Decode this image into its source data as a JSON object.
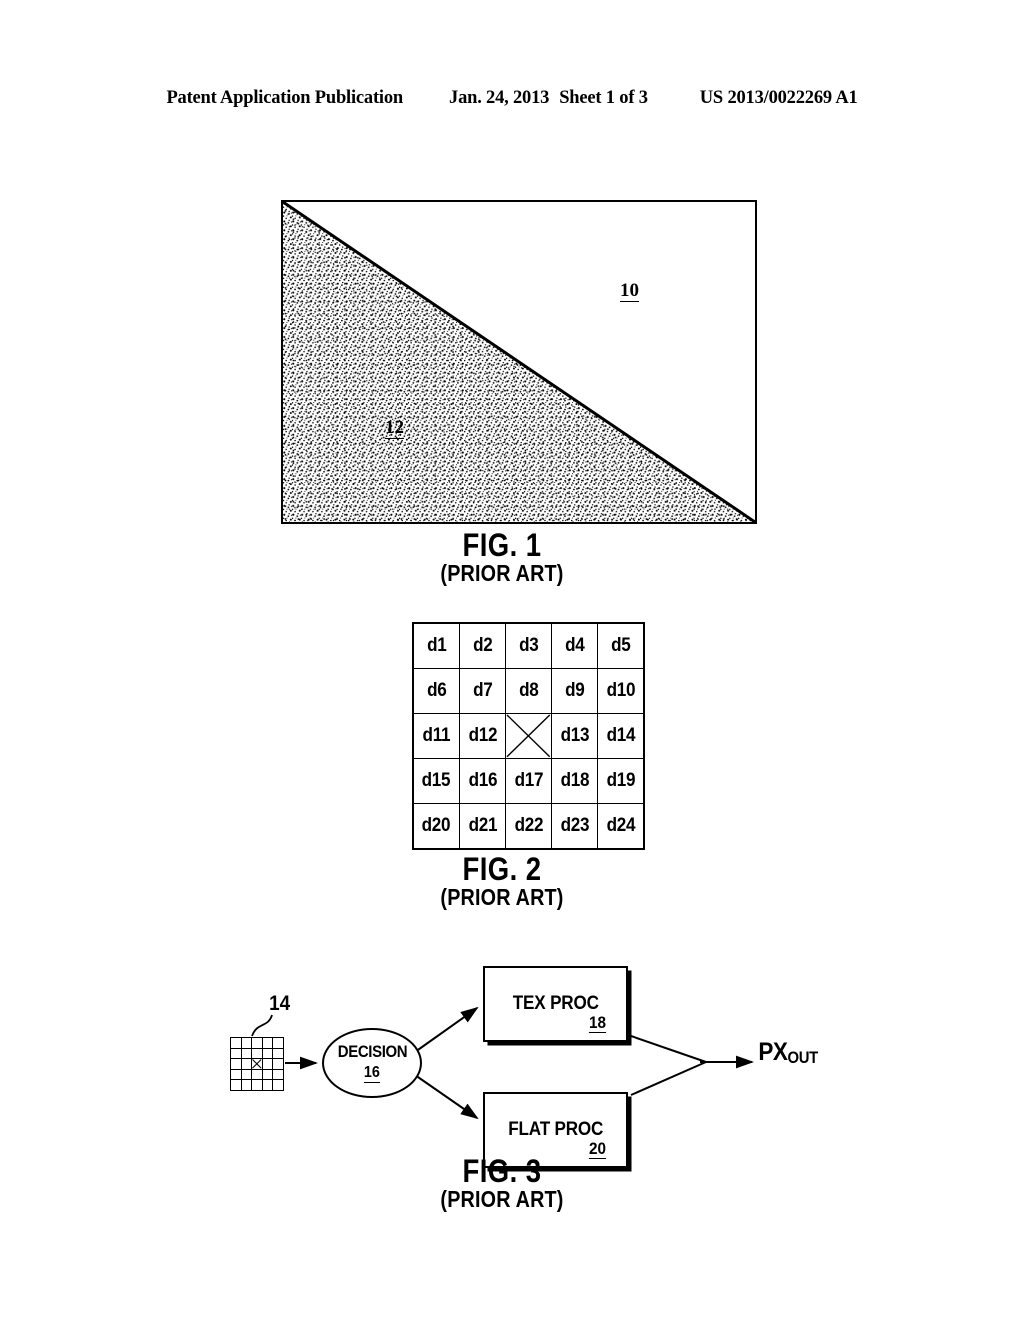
{
  "header": {
    "publication": "Patent Application Publication",
    "date": "Jan. 24, 2013",
    "sheet": "Sheet 1 of 3",
    "patent_number": "US 2013/0022269 A1"
  },
  "figures": [
    {
      "id": "fig1",
      "number": "FIG. 1",
      "subtitle": "(PRIOR ART)",
      "type": "stippled-triangle-diagram",
      "refs": [
        {
          "label": "10",
          "region": "white-upper-right-region"
        },
        {
          "label": "12",
          "region": "stippled-lower-left-triangle"
        }
      ]
    },
    {
      "id": "fig2",
      "number": "FIG. 2",
      "subtitle": "(PRIOR ART)",
      "type": "pixel-neighborhood-grid",
      "grid": {
        "rows": 5,
        "cols": 5,
        "center_marker": "x-cross",
        "cells": [
          [
            "d1",
            "d2",
            "d3",
            "d4",
            "d5"
          ],
          [
            "d6",
            "d7",
            "d8",
            "d9",
            "d10"
          ],
          [
            "d11",
            "d12",
            "",
            "d13",
            "d14"
          ],
          [
            "d15",
            "d16",
            "d17",
            "d18",
            "d19"
          ],
          [
            "d20",
            "d21",
            "d22",
            "d23",
            "d24"
          ]
        ]
      }
    },
    {
      "id": "fig3",
      "number": "FIG. 3",
      "subtitle": "(PRIOR ART)",
      "type": "block-flow-diagram",
      "nodes": {
        "input_grid": {
          "ref": "14",
          "rows": 5,
          "cols": 5,
          "center_marker": "x-cross"
        },
        "decision": {
          "label": "DECISION",
          "ref": "16",
          "shape": "ellipse"
        },
        "tex_proc": {
          "label": "TEX PROC",
          "ref": "18",
          "shape": "box"
        },
        "flat_proc": {
          "label": "FLAT PROC",
          "ref": "20",
          "shape": "box"
        },
        "output": {
          "label": "PX",
          "subscript": "OUT"
        }
      }
    }
  ]
}
